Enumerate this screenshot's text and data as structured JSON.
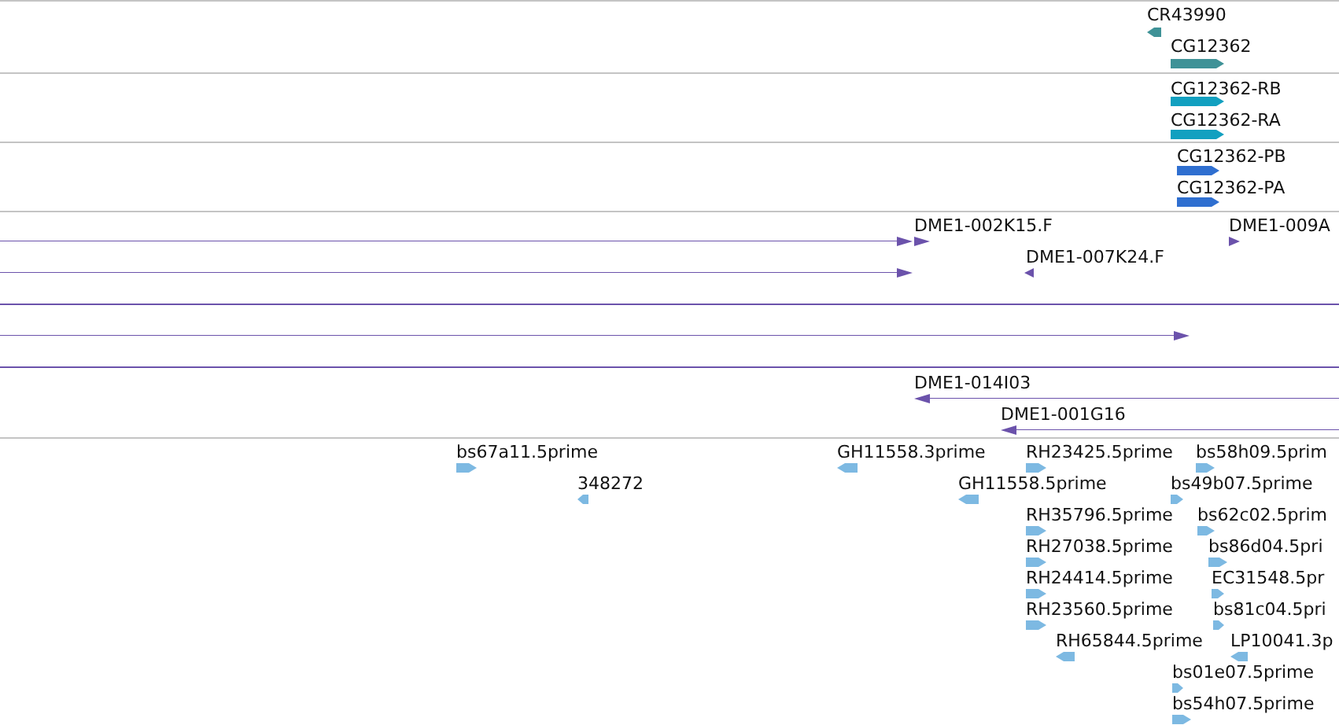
{
  "tracks": [
    {
      "kind": "bar",
      "color": "#3f9297",
      "features": [
        {
          "label": "CR43990",
          "kind": "reverse"
        },
        {
          "label": "CG12362",
          "kind": "forward"
        }
      ]
    },
    {
      "kind": "bar",
      "color": "#12a0c0",
      "features": [
        {
          "label": "CG12362-RB",
          "kind": "forward"
        },
        {
          "label": "CG12362-RA",
          "kind": "forward"
        }
      ]
    },
    {
      "kind": "bar",
      "color": "#2f6fd0",
      "features": [
        {
          "label": "CG12362-PB",
          "kind": "forward"
        },
        {
          "label": "CG12362-PA",
          "kind": "forward"
        }
      ]
    },
    {
      "kind": "line",
      "color": "#6b52ab",
      "features": [
        {
          "kind": "forward"
        },
        {
          "label": "DME1-002K15.F",
          "kind": "forward"
        },
        {
          "label": "DME1-009A",
          "kind": "forward"
        },
        {
          "kind": "forward"
        },
        {
          "label": "DME1-007K24.F",
          "kind": "reverse"
        },
        {
          "kind": "plain"
        },
        {
          "kind": "forward"
        },
        {
          "kind": "plain"
        },
        {
          "label": "DME1-014I03",
          "kind": "reverse"
        },
        {
          "label": "DME1-001G16",
          "kind": "reverse"
        }
      ]
    },
    {
      "kind": "bar",
      "color": "#7db9e2",
      "features": [
        {
          "label": "bs67a11.5prime",
          "kind": "forward"
        },
        {
          "label": "GH11558.3prime",
          "kind": "reverse"
        },
        {
          "label": "RH23425.5prime",
          "kind": "forward"
        },
        {
          "label": "bs58h09.5prim",
          "kind": "forward"
        },
        {
          "label": "348272",
          "kind": "reverse"
        },
        {
          "label": "GH11558.5prime",
          "kind": "reverse"
        },
        {
          "label": "bs49b07.5prime",
          "kind": "forward"
        },
        {
          "label": "RH35796.5prime",
          "kind": "forward"
        },
        {
          "label": "bs62c02.5prim",
          "kind": "forward"
        },
        {
          "label": "RH27038.5prime",
          "kind": "forward"
        },
        {
          "label": "bs86d04.5pri",
          "kind": "forward"
        },
        {
          "label": "RH24414.5prime",
          "kind": "forward"
        },
        {
          "label": "EC31548.5pr",
          "kind": "forward"
        },
        {
          "label": "RH23560.5prime",
          "kind": "forward"
        },
        {
          "label": "bs81c04.5pri",
          "kind": "forward"
        },
        {
          "label": "RH65844.5prime",
          "kind": "reverse"
        },
        {
          "label": "LP10041.3p",
          "kind": "reverse"
        },
        {
          "label": "bs01e07.5prime",
          "kind": "forward"
        },
        {
          "label": "bs54h07.5prime",
          "kind": "forward"
        }
      ]
    }
  ]
}
